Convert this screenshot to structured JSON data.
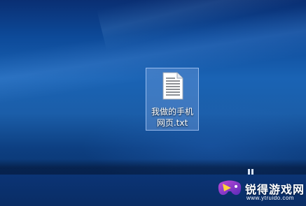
{
  "desktop": {
    "icons": [
      {
        "label": "我做的手机网页.txt",
        "type": "text-file-icon",
        "selected": true
      }
    ]
  },
  "watermark": {
    "title": "锐得游戏网",
    "url": "www.ytruido.com",
    "logo": "gamepad-logo"
  },
  "colors": {
    "accent": "#1a63b4",
    "selection": "#82aae6"
  }
}
